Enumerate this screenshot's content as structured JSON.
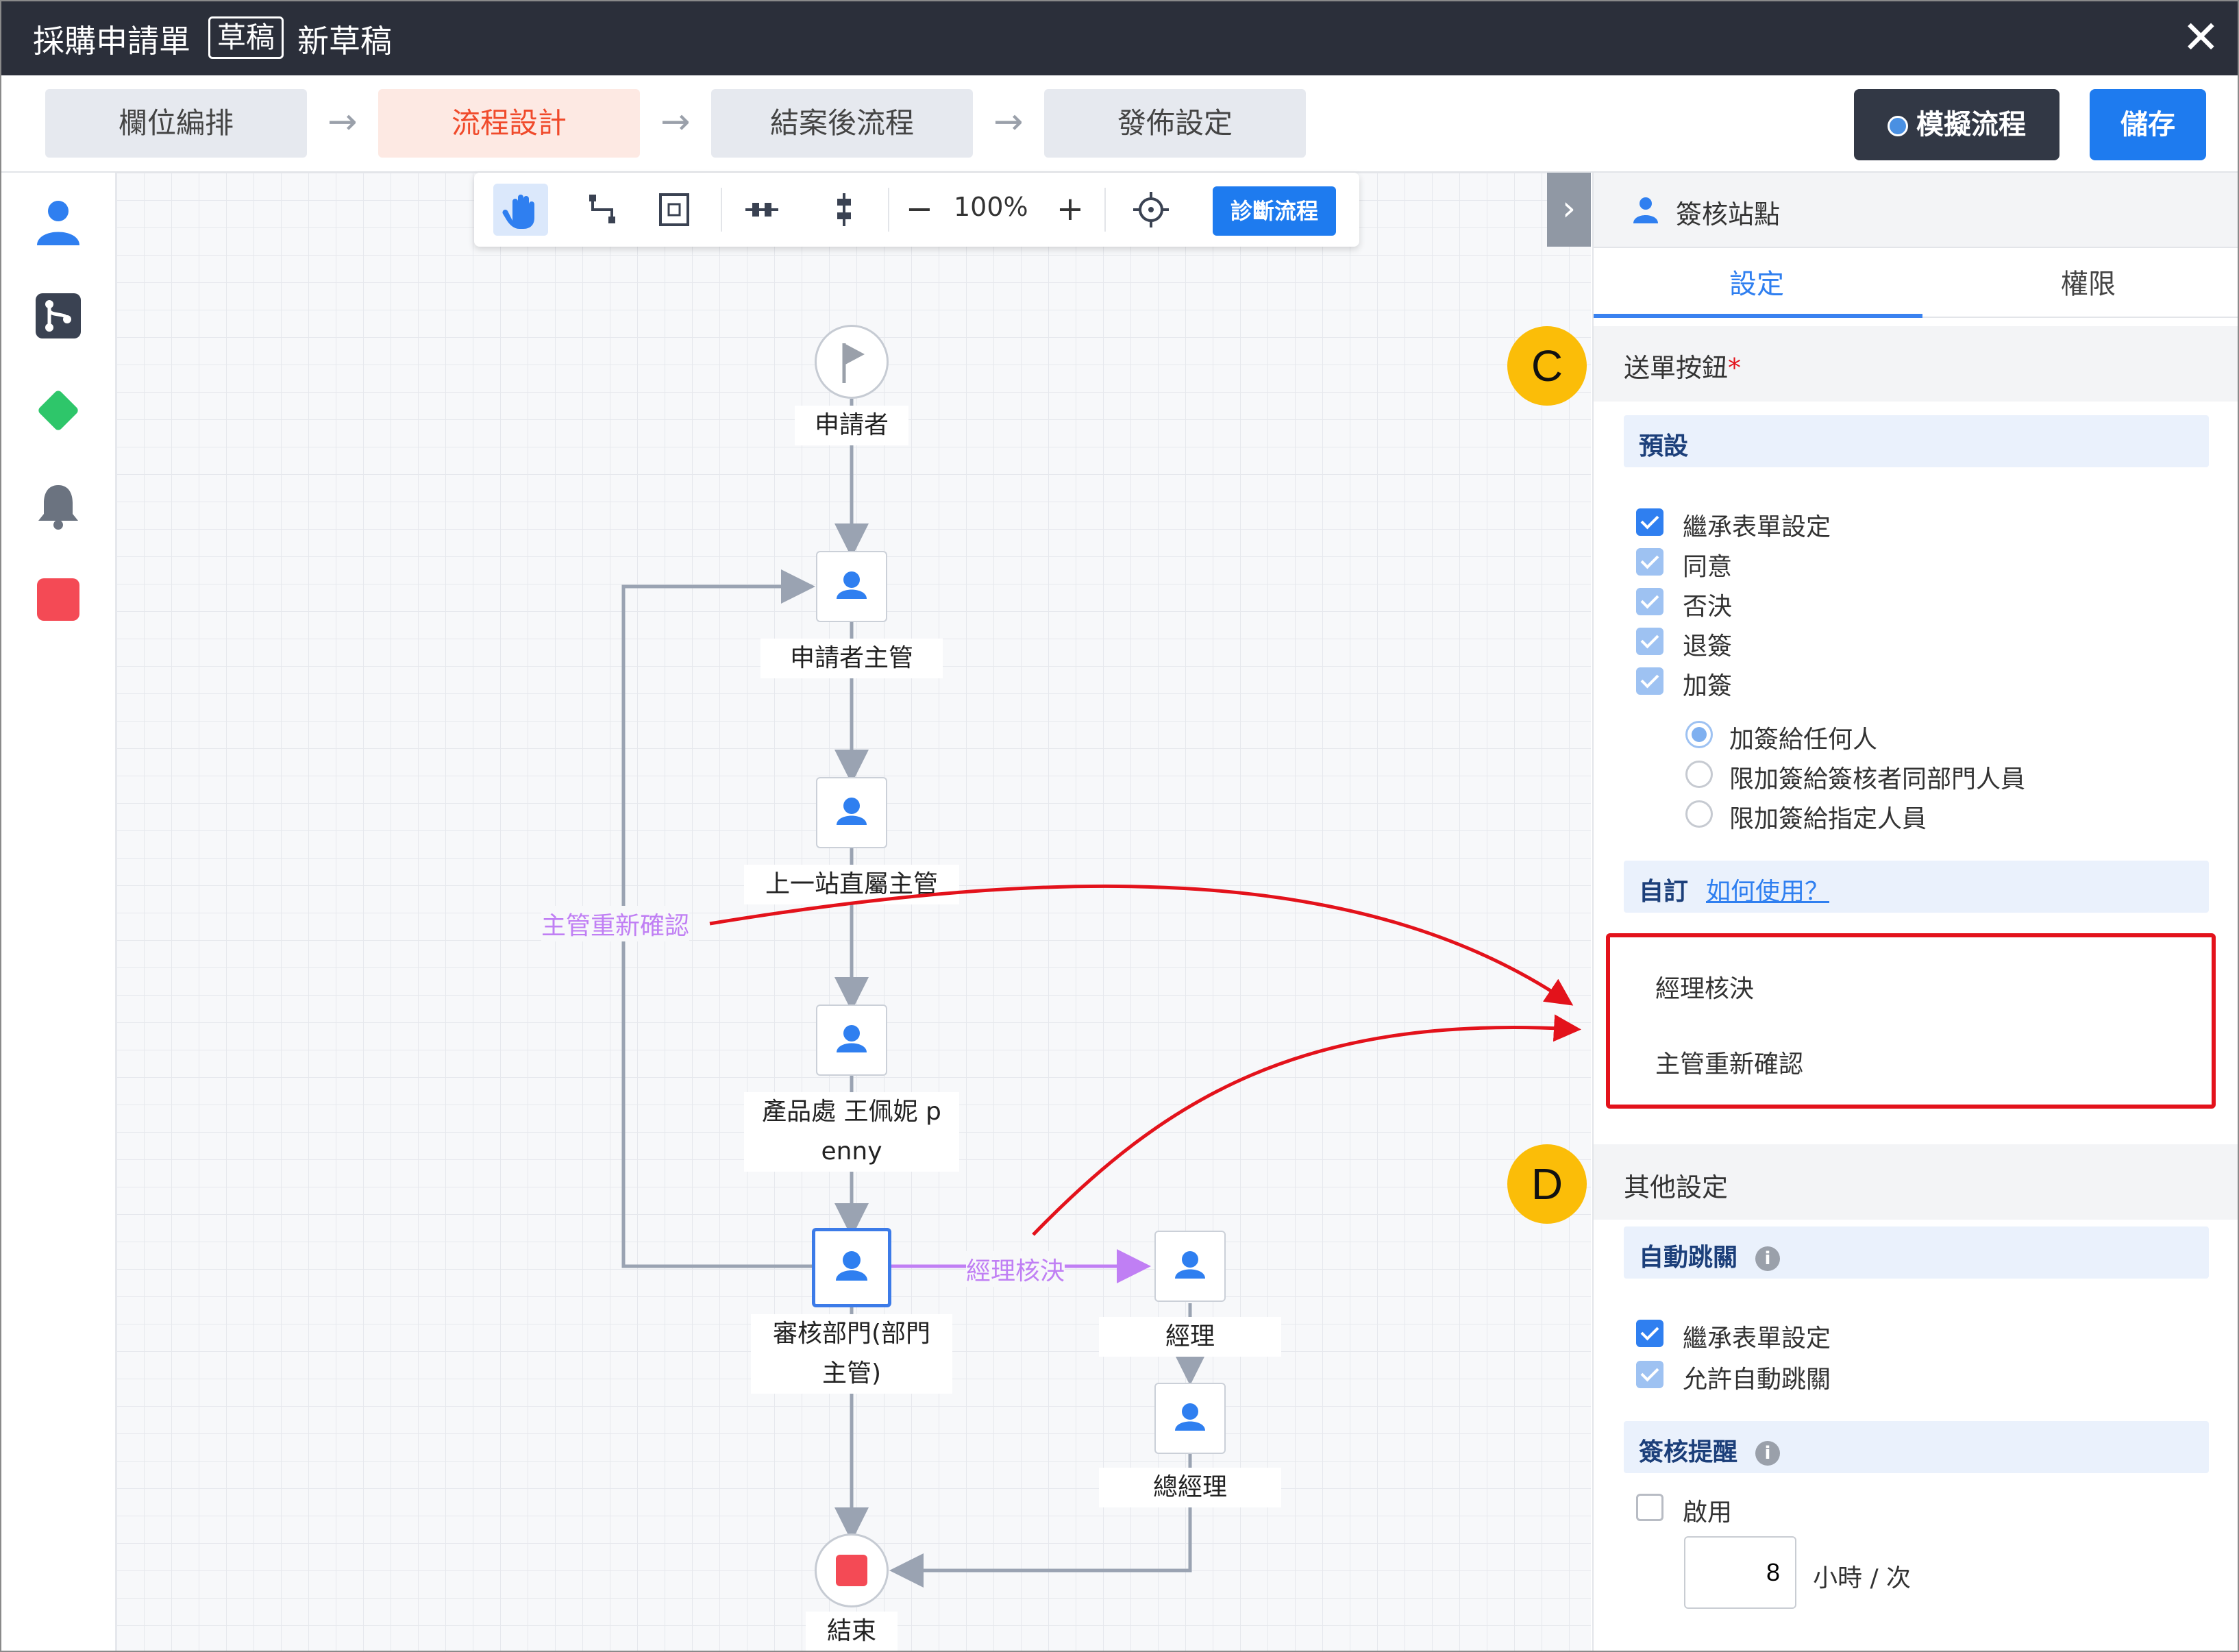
{
  "title_bar": {
    "title": "採購申請單",
    "status_badge": "草稿",
    "draft_name": "新草稿",
    "close_label": "✕"
  },
  "steps": [
    {
      "label": "欄位編排",
      "active": false
    },
    {
      "label": "流程設計",
      "active": true
    },
    {
      "label": "結案後流程",
      "active": false
    },
    {
      "label": "發佈設定",
      "active": false
    }
  ],
  "step_arrow": "→",
  "header_buttons": {
    "simulate": "模擬流程",
    "save": "儲存"
  },
  "left_toolbar": [
    "user-icon",
    "branch-icon",
    "diamond-icon",
    "bell-icon",
    "stop-icon"
  ],
  "canvas_toolbar": {
    "tools": [
      "hand-icon",
      "connector-icon",
      "frame-icon",
      "align-horizontal-icon",
      "align-vertical-icon"
    ],
    "zoom_out": "−",
    "zoom": "100%",
    "zoom_in": "+",
    "diagnose": "診斷流程"
  },
  "flow": {
    "start_label": "申請者",
    "end_label": "結束",
    "nodes": [
      {
        "id": "n1",
        "label": "申請者主管"
      },
      {
        "id": "n2",
        "label": "上一站直屬主管"
      },
      {
        "id": "n3",
        "label_line1": "產品處 王佩妮 p",
        "label_line2": "enny"
      },
      {
        "id": "n4",
        "label_line1": "審核部門(部門",
        "label_line2": "主管)",
        "selected": true
      },
      {
        "id": "n5",
        "label": "經理"
      },
      {
        "id": "n6",
        "label": "總經理"
      }
    ],
    "edge_labels": {
      "recheck": "主管重新確認",
      "manager_decision": "經理核決"
    }
  },
  "panel": {
    "title": "簽核站點",
    "tabs": [
      {
        "label": "設定",
        "active": true
      },
      {
        "label": "權限",
        "active": false
      }
    ],
    "submit_section": {
      "title": "送單按鈕",
      "required_mark": "*",
      "default_group": "預設",
      "checkboxes": [
        {
          "label": "繼承表單設定",
          "state": "checked"
        },
        {
          "label": "同意",
          "state": "checked-disabled"
        },
        {
          "label": "否決",
          "state": "checked-disabled"
        },
        {
          "label": "退簽",
          "state": "checked-disabled"
        },
        {
          "label": "加簽",
          "state": "checked-disabled"
        }
      ],
      "radios": [
        {
          "label": "加簽給任何人",
          "selected": true
        },
        {
          "label": "限加簽給簽核者同部門人員",
          "selected": false
        },
        {
          "label": "限加簽給指定人員",
          "selected": false
        }
      ],
      "custom_group": "自訂",
      "custom_help": "如何使用？",
      "custom_items": [
        "經理核決",
        "主管重新確認"
      ]
    },
    "other_section": {
      "title": "其他設定",
      "auto_skip": {
        "title": "自動跳關",
        "checkboxes": [
          {
            "label": "繼承表單設定",
            "state": "checked"
          },
          {
            "label": "允許自動跳關",
            "state": "checked-disabled"
          }
        ]
      },
      "reminder": {
        "title": "簽核提醒",
        "enable_label": "啟用",
        "enabled": false,
        "hours_value": "8",
        "unit": "小時 / 次"
      }
    }
  },
  "markers": {
    "c": "C",
    "d": "D"
  },
  "colors": {
    "accent": "#1e7bef",
    "active_step_text": "#f04a2b",
    "highlight_box": "#e3121b",
    "annotation_arrow": "#e3121b",
    "edge_label": "#c07ff4",
    "marker": "#fbbd08"
  }
}
